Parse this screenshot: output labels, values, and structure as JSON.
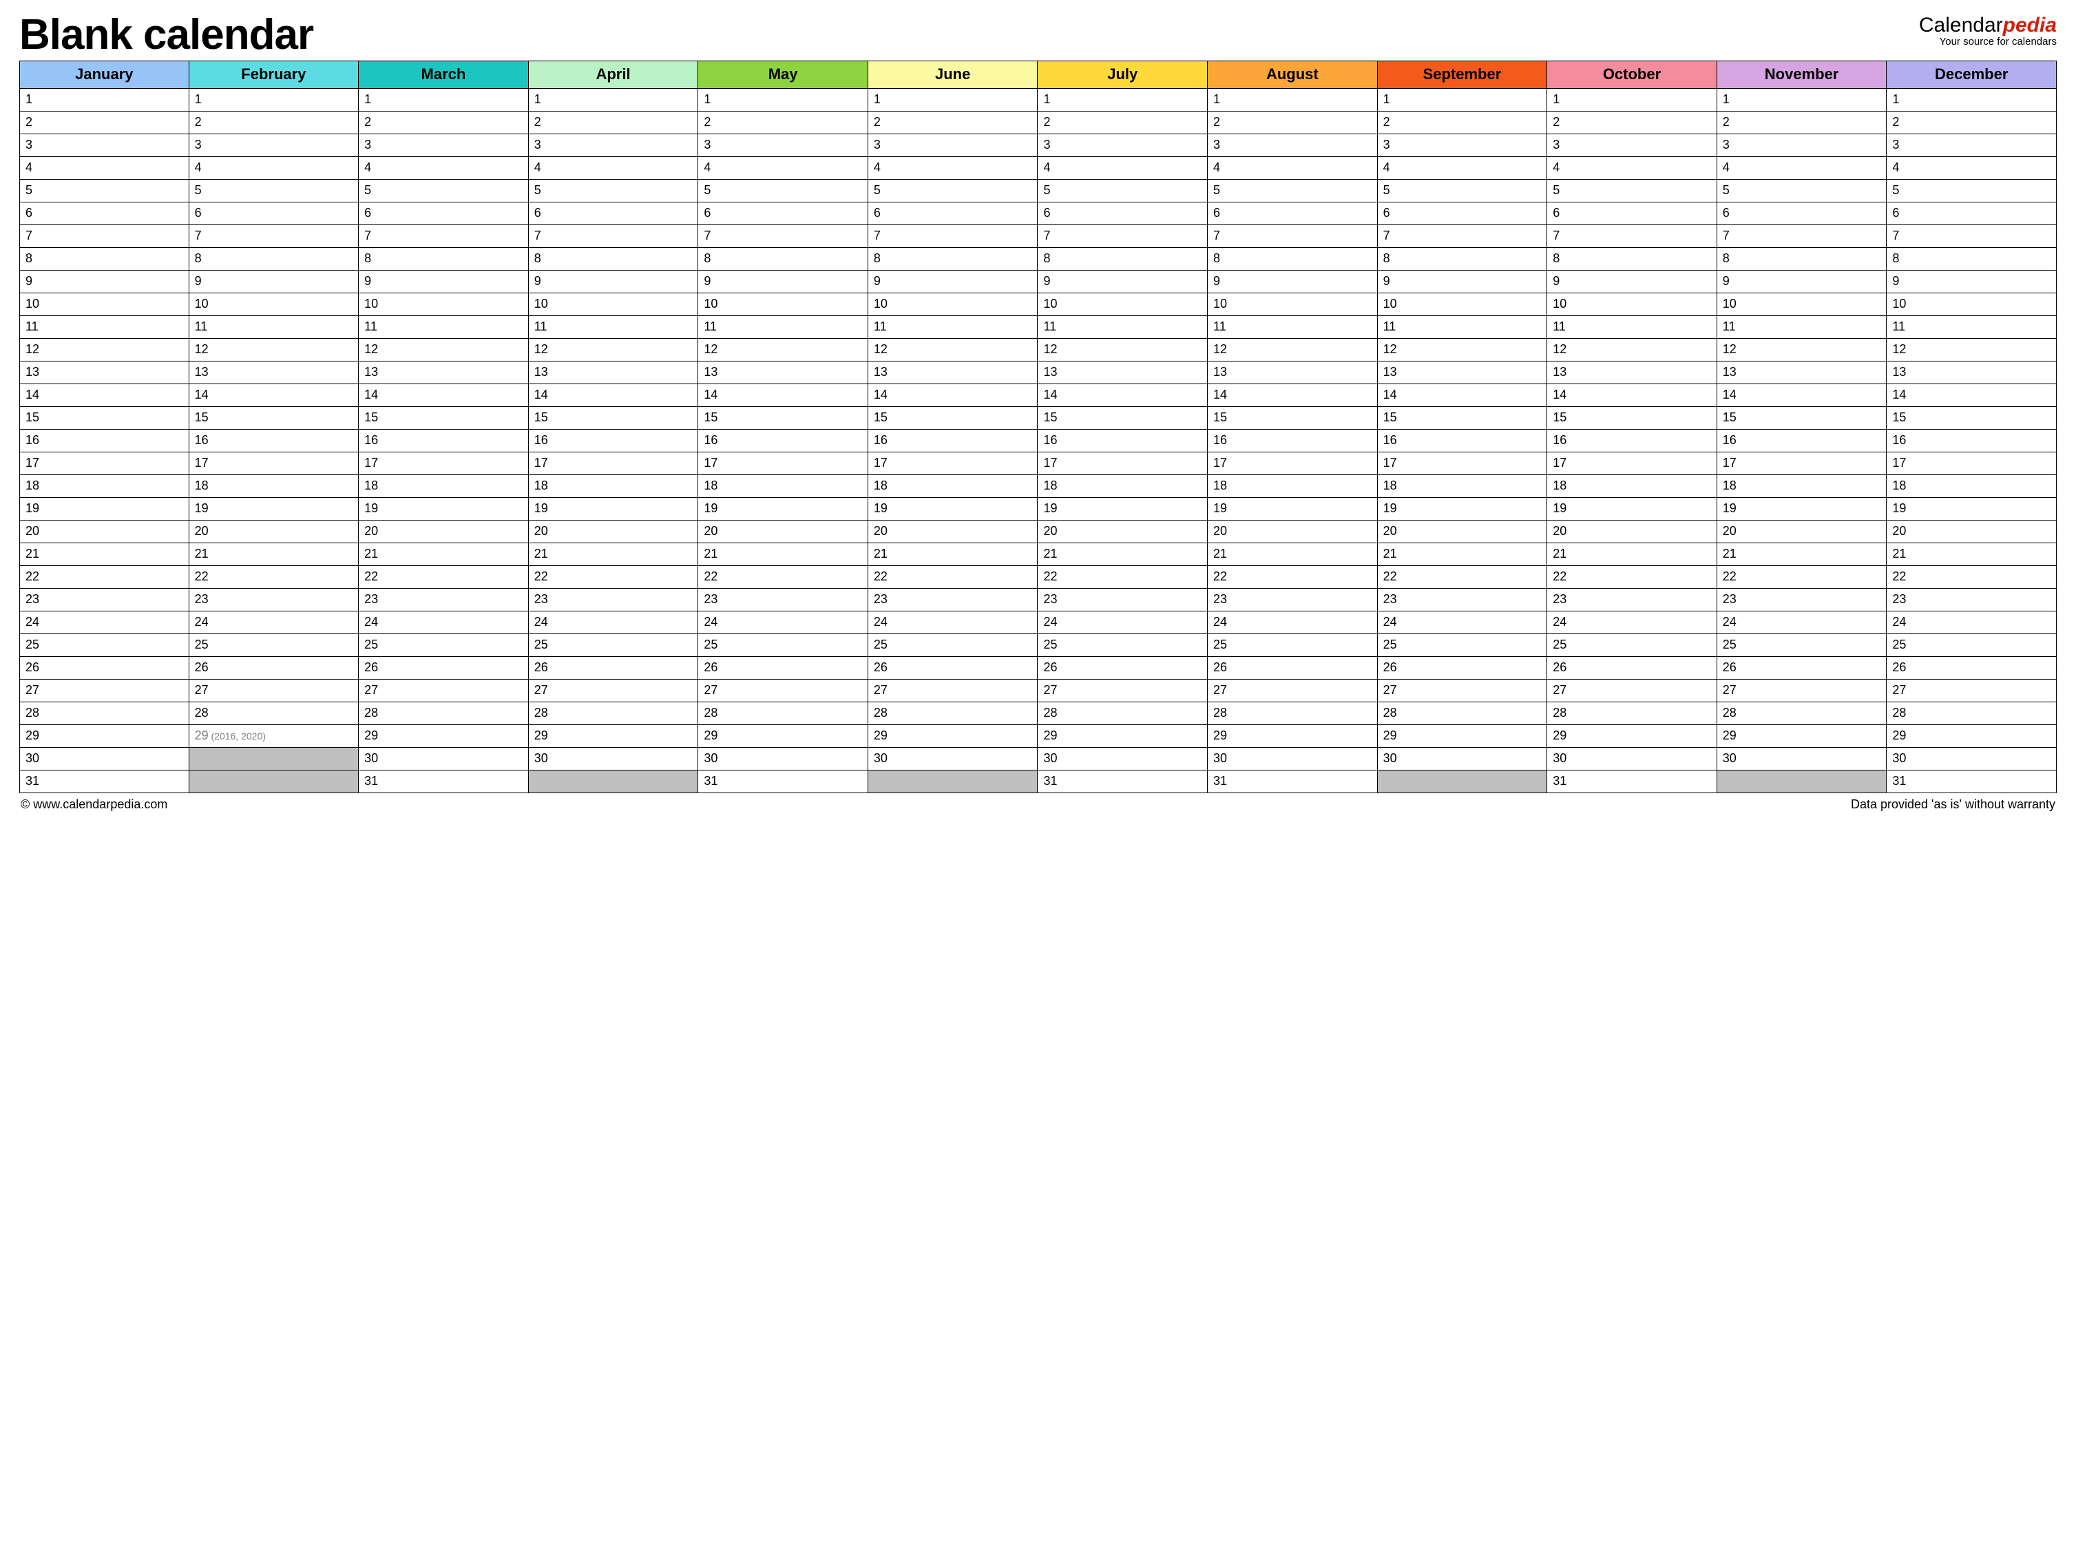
{
  "title": "Blank calendar",
  "brand": {
    "left": "Calendar",
    "right": "pedia",
    "tagline": "Your source for calendars"
  },
  "months": [
    {
      "name": "January",
      "days": 31
    },
    {
      "name": "February",
      "days": 29,
      "leap": {
        "day": 29,
        "note": "(2016, 2020)"
      }
    },
    {
      "name": "March",
      "days": 31
    },
    {
      "name": "April",
      "days": 30
    },
    {
      "name": "May",
      "days": 31
    },
    {
      "name": "June",
      "days": 30
    },
    {
      "name": "July",
      "days": 31
    },
    {
      "name": "August",
      "days": 31
    },
    {
      "name": "September",
      "days": 30
    },
    {
      "name": "October",
      "days": 31
    },
    {
      "name": "November",
      "days": 30
    },
    {
      "name": "December",
      "days": 31
    }
  ],
  "max_rows": 31,
  "footer": {
    "left": "© www.calendarpedia.com",
    "right": "Data provided 'as is' without warranty"
  }
}
